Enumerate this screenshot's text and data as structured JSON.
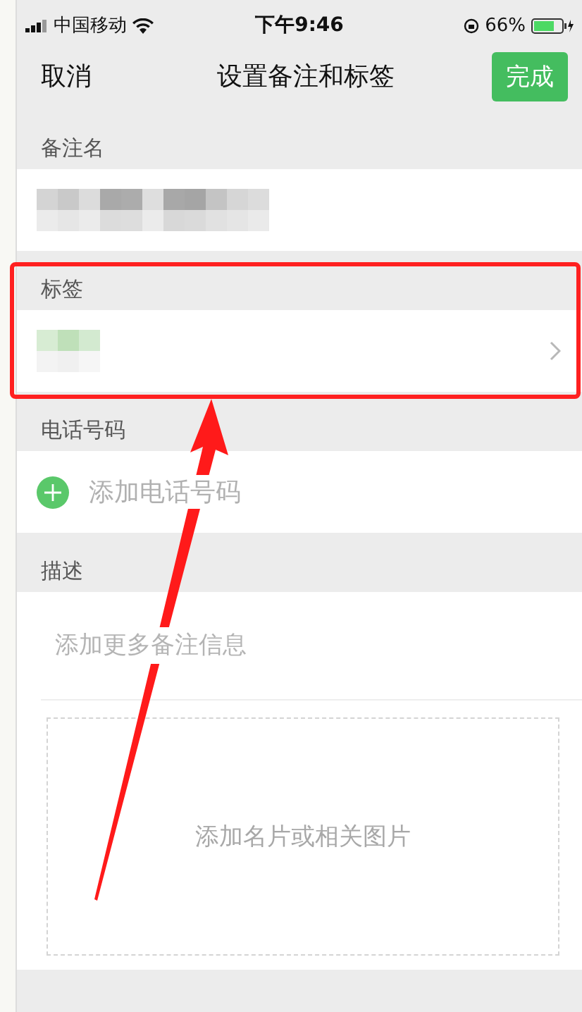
{
  "status_bar": {
    "carrier": "中国移动",
    "time": "下午9:46",
    "battery": "66%"
  },
  "nav": {
    "cancel": "取消",
    "title": "设置备注和标签",
    "done": "完成"
  },
  "sections": [
    {
      "kind": "mosaic",
      "header": "备注名"
    },
    {
      "kind": "tags",
      "header": "标签"
    },
    {
      "kind": "add",
      "header": "电话号码",
      "placeholder": "添加电话号码"
    },
    {
      "kind": "description",
      "header": "描述",
      "placeholder": "添加更多备注信息",
      "photo_hint": "添加名片或相关图片"
    }
  ]
}
